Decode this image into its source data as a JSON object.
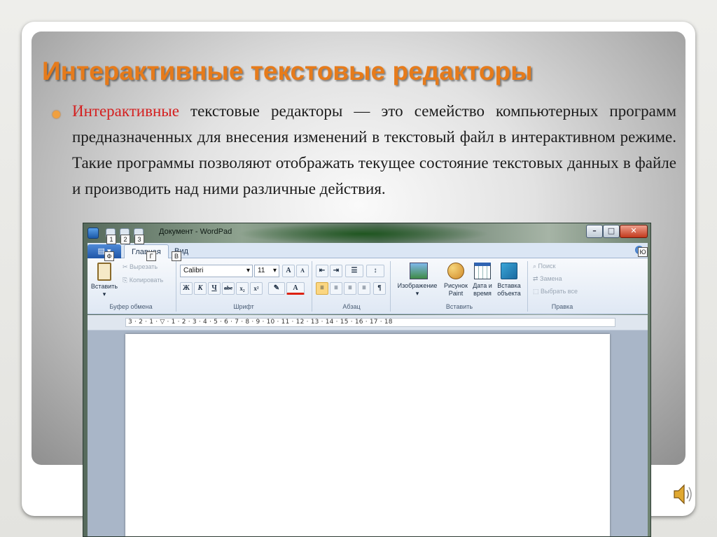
{
  "slide": {
    "title": "Интерактивные текстовые редакторы",
    "bullet_highlight": "Интерактивные",
    "bullet_text": " текстовые редакторы — это семейство компьютерных программ предназначенных для внесения изменений в текстовый файл в интерактивном режиме. Такие программы позволяют отображать текущее состояние текстовых данных в файле и производить над ними различные действия.",
    "colors": {
      "title": "#e67b1b",
      "highlight": "#d42020",
      "bullet": "#f0a040"
    }
  },
  "wordpad": {
    "window_title": "Документ - WordPad",
    "window_buttons": {
      "minimize": "–",
      "maximize": "□",
      "close": "✕"
    },
    "qat_keytips": [
      "1",
      "2",
      "3"
    ],
    "tabs": {
      "file_keytip": "Ф",
      "home": "Главная",
      "home_keytip": "Г",
      "view": "Вид",
      "view_keytip": "В",
      "help_keytip": "Ю"
    },
    "clipboard": {
      "paste": "Вставить",
      "cut": "Вырезать",
      "copy": "Копировать",
      "label": "Буфер обмена"
    },
    "font": {
      "name": "Calibri",
      "size": "11",
      "grow": "A",
      "shrink": "A",
      "bold": "Ж",
      "italic": "К",
      "underline": "Ч",
      "strike": "abc",
      "sub": "x₂",
      "sup": "x²",
      "color": "A",
      "label": "Шрифт"
    },
    "paragraph": {
      "label": "Абзац"
    },
    "insert": {
      "image": "Изображение",
      "paint": "Рисунок Paint",
      "datetime": "Дата и время",
      "object": "Вставка объекта",
      "label": "Вставить"
    },
    "editing": {
      "find": "Поиск",
      "replace": "Замена",
      "select_all": "Выбрать все",
      "label": "Правка"
    },
    "ruler": "3 · 2 · 1 · ▽ · 1 · 2 · 3 · 4 · 5 · 6 · 7 · 8 · 9 · 10 · 11 · 12 · 13 · 14 · 15 · 16 · 17 · 18"
  }
}
